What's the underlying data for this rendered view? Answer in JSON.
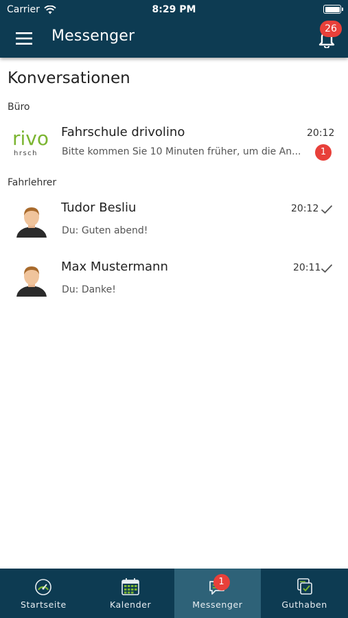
{
  "status_bar": {
    "carrier": "Carrier",
    "time": "8:29 PM"
  },
  "app_bar": {
    "title": "Messenger",
    "notifications_count": "26"
  },
  "page": {
    "title": "Konversationen"
  },
  "sections": [
    {
      "label": "Büro",
      "conversations": [
        {
          "name": "Fahrschule drivolino",
          "time": "20:12",
          "preview": "Bitte kommen Sie 10 Minuten früher, um die An...",
          "unread": "1",
          "logo_text_top": "rivo",
          "logo_text_bottom": "hrsch"
        }
      ]
    },
    {
      "label": "Fahrlehrer",
      "conversations": [
        {
          "name": "Tudor Besliu",
          "time": "20:12",
          "preview": "Du: Guten abend!",
          "read": true
        },
        {
          "name": "Max Mustermann",
          "time": "20:11",
          "preview": "Du: Danke!",
          "read": true
        }
      ]
    }
  ],
  "bottom_nav": {
    "items": [
      {
        "label": "Startseite",
        "icon": "speedometer-icon"
      },
      {
        "label": "Kalender",
        "icon": "calendar-icon"
      },
      {
        "label": "Messenger",
        "icon": "chat-icon",
        "badge": "1",
        "active": true
      },
      {
        "label": "Guthaben",
        "icon": "wallet-icon"
      }
    ]
  },
  "colors": {
    "primary": "#0d3b52",
    "active_tab": "#2e6278",
    "badge": "#e8403a",
    "logo_green": "#7bb531"
  }
}
